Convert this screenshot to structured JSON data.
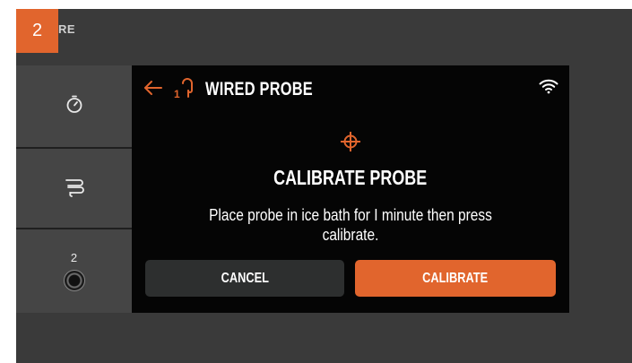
{
  "step_badge": "2",
  "top_label": "RE",
  "sidebar": {
    "items": [
      {
        "name": "timer",
        "icon": "stopwatch-icon"
      },
      {
        "name": "smoke",
        "icon": "smoke-icon"
      },
      {
        "name": "probe-port",
        "label": "2",
        "icon": "probe-jack-icon"
      }
    ]
  },
  "modal": {
    "header_title": "WIRED PROBE",
    "back_icon": "back-arrow-icon",
    "probe_icon": "probe-1-icon",
    "wifi_icon": "wifi-icon",
    "target_icon": "crosshair-icon",
    "title": "CALIBRATE PROBE",
    "description": "Place probe in ice bath for I minute then press calibrate.",
    "cancel_label": "CANCEL",
    "calibrate_label": "CALIBRATE"
  },
  "colors": {
    "accent": "#e1652d",
    "modal_bg": "#050505",
    "device_bg": "#3a3a3a",
    "sidebar_bg": "#454545",
    "cancel_bg": "#2d2f2f"
  }
}
